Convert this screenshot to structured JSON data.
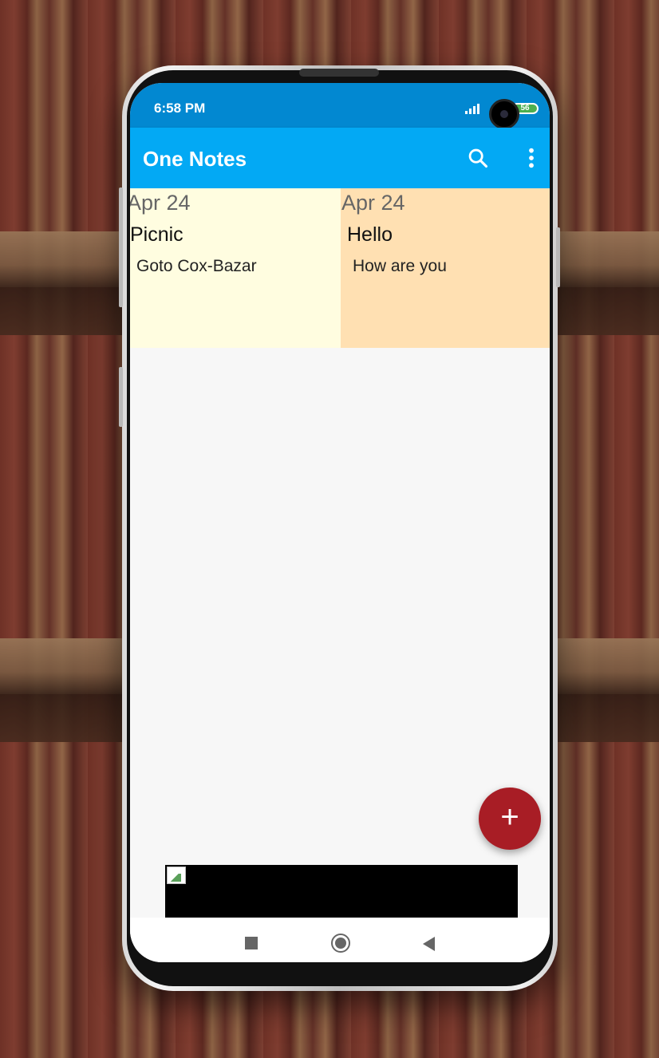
{
  "status_bar": {
    "time": "6:58 PM",
    "battery": "56",
    "icons": [
      "signal-icon",
      "battery-icon"
    ]
  },
  "app_bar": {
    "title": "One Notes",
    "icons": [
      "search-icon",
      "more-vert-icon"
    ]
  },
  "notes": [
    {
      "date": "Apr 24",
      "title": "Picnic",
      "body": "Goto Cox-Bazar",
      "color": "#fffde0"
    },
    {
      "date": "Apr 24",
      "title": "Hello",
      "body": "How are you",
      "color": "#ffe0b2"
    }
  ],
  "fab": {
    "label": "+",
    "color": "#a81d25",
    "icon": "add-icon"
  },
  "nav_bar": {
    "icons": [
      "recent-apps-icon",
      "home-icon",
      "back-icon"
    ]
  },
  "colors": {
    "status_bar": "#0288d1",
    "app_bar": "#03a9f4",
    "background": "#f7f7f7"
  }
}
